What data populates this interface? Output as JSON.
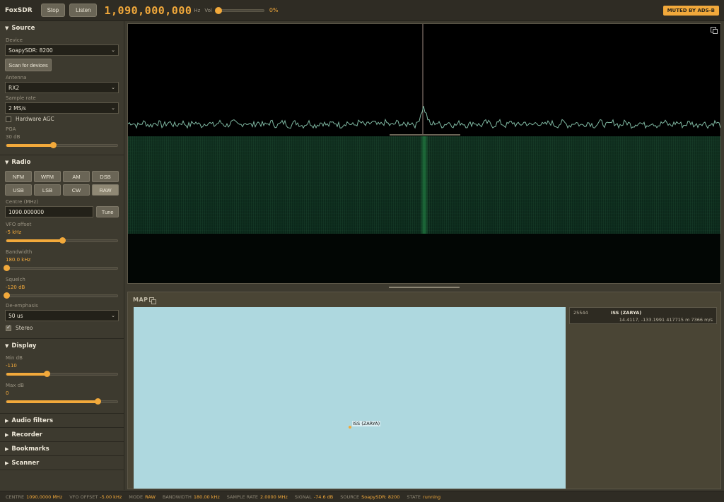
{
  "app": {
    "title": "FoxSDR"
  },
  "topbar": {
    "stop_label": "Stop",
    "listen_label": "Listen",
    "frequency": "1,090,000,000",
    "freq_unit": "Hz",
    "vol_label": "Vol",
    "vol_value": "0%",
    "vol_level": 0,
    "muted_badge": "MUTED BY ADS-B"
  },
  "source": {
    "title": "Source",
    "device_label": "Device",
    "device_value": "SoapySDR: 8200",
    "scan_label": "Scan for devices",
    "antenna_label": "Antenna",
    "antenna_value": "RX2",
    "sample_rate_label": "Sample rate",
    "sample_rate_value": "2 MS/s",
    "hw_agc_label": "Hardware AGC",
    "hw_agc_checked": false,
    "pga_label": "PGA",
    "pga_value": "30 dB",
    "pga_level": 0.42
  },
  "radio": {
    "title": "Radio",
    "modes": [
      "NFM",
      "WFM",
      "AM",
      "DSB",
      "USB",
      "LSB",
      "CW",
      "RAW"
    ],
    "active_mode": "RAW",
    "centre_label": "Centre (MHz)",
    "centre_value": "1090.000000",
    "tune_label": "Tune",
    "vfo_label": "VFO offset",
    "vfo_value": "-5 kHz",
    "vfo_level": 0.5,
    "bandwidth_label": "Bandwidth",
    "bandwidth_value": "180.0 kHz",
    "bandwidth_level": 0,
    "squelch_label": "Squelch",
    "squelch_value": "-120 dB",
    "squelch_level": 0,
    "deemph_label": "De-emphasis",
    "deemph_value": "50 us",
    "stereo_label": "Stereo",
    "stereo_checked": true
  },
  "display": {
    "title": "Display",
    "min_label": "Min dB",
    "min_value": "-110",
    "min_level": 0.36,
    "max_label": "Max dB",
    "max_value": "0",
    "max_level": 0.82
  },
  "collapsed": {
    "audio_filters": "Audio filters",
    "recorder": "Recorder",
    "bookmarks": "Bookmarks",
    "scanner": "Scanner"
  },
  "map": {
    "title": "MAP",
    "satellite": {
      "id": "25544",
      "name": "ISS (ZARYA)",
      "details": "14.4117, -133.1991 417715 m 7366 m/s",
      "marker_label": "ISS (ZARYA)"
    }
  },
  "status": {
    "centre_key": "Centre",
    "centre_val": "1090.0000 MHz",
    "vfo_key": "VFO offset",
    "vfo_val": "-5.00 kHz",
    "mode_key": "Mode",
    "mode_val": "RAW",
    "bw_key": "Bandwidth",
    "bw_val": "180.00 kHz",
    "sr_key": "Sample rate",
    "sr_val": "2.0000 MHz",
    "sig_key": "Signal",
    "sig_val": "-74.6 dB",
    "src_key": "Source",
    "src_val": "SoapySDR: 8200",
    "state_key": "State",
    "state_val": "running"
  },
  "colors": {
    "accent": "#f2a93b",
    "fft_trace": "#7fb8a2",
    "waterfall": "#0f2d1d",
    "map_bg": "#aed8df"
  }
}
